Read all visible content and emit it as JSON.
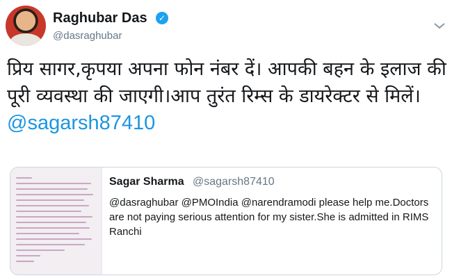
{
  "author": {
    "display_name": "Raghubar Das",
    "handle": "@dasraghubar",
    "verified_icon": "verified-badge-icon",
    "more_icon": "chevron-down-icon"
  },
  "tweet": {
    "text_part": "प्रिय सागर,कृपया अपना फोन नंबर दें। आपकी बहन के इलाज की पूरी व्यवस्था की जाएगी।आप तुरंत रिम्स के डायरेक्टर से मिलें। ",
    "mention": "@sagarsh87410"
  },
  "quoted_tweet": {
    "display_name": "Sagar Sharma",
    "handle": "@sagarsh87410",
    "text": "@dasraghubar @PMOIndia @narendramodi please help me.Doctors are not paying serious attention for my sister.She is admitted in  RIMS Ranchi",
    "image_icon": "letter-image-icon"
  },
  "colors": {
    "link": "#1b95e0",
    "muted": "#657786",
    "text": "#14171a",
    "border": "#ccd6dd"
  }
}
